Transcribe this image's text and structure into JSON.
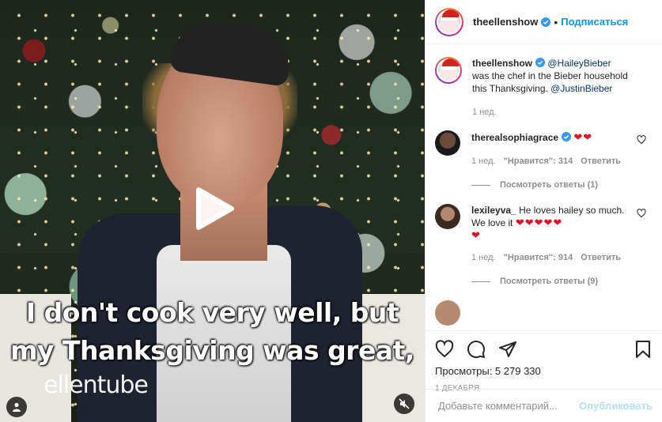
{
  "video": {
    "caption_line1": "I don't cook very well, but",
    "caption_line2": "my Thanksgiving was great,",
    "watermark": "ellentube"
  },
  "header": {
    "username": "theellenshow",
    "separator": "•",
    "follow_label": "Подписаться"
  },
  "post": {
    "username": "theellenshow",
    "mention1": "@HaileyBieber",
    "text": " was the chef in the Bieber household this Thanksgiving. ",
    "mention2": "@JustinBieber",
    "time": "1 нед."
  },
  "comments": [
    {
      "username": "therealsophiagrace",
      "text": "",
      "emoji": "❤❤",
      "time": "1 нед.",
      "likes": "\"Нравится\": 314",
      "reply_label": "Ответить",
      "view_replies": "Посмотреть ответы (1)"
    },
    {
      "username": "lexileyva_",
      "text": "He loves hailey so much. We love it",
      "emoji": "❤❤❤❤❤",
      "emoji2": "❤",
      "time": "1 нед.",
      "likes": "\"Нравится\": 914",
      "reply_label": "Ответить",
      "view_replies": "Посмотреть ответы (9)"
    }
  ],
  "actions": {
    "views": "Просмотры: 5 279 330",
    "date": "1 ДЕКАБРЯ"
  },
  "add_comment": {
    "placeholder": "Добавьте комментарий...",
    "publish_label": "Опубликовать"
  },
  "colors": {
    "accent": "#0095f6",
    "heart": "#e0102a",
    "publish_disabled": "#b2dffc"
  },
  "icons": [
    "play-icon",
    "user-icon",
    "mute-icon",
    "verified-icon",
    "heart-icon",
    "comment-icon",
    "share-icon",
    "bookmark-icon"
  ]
}
